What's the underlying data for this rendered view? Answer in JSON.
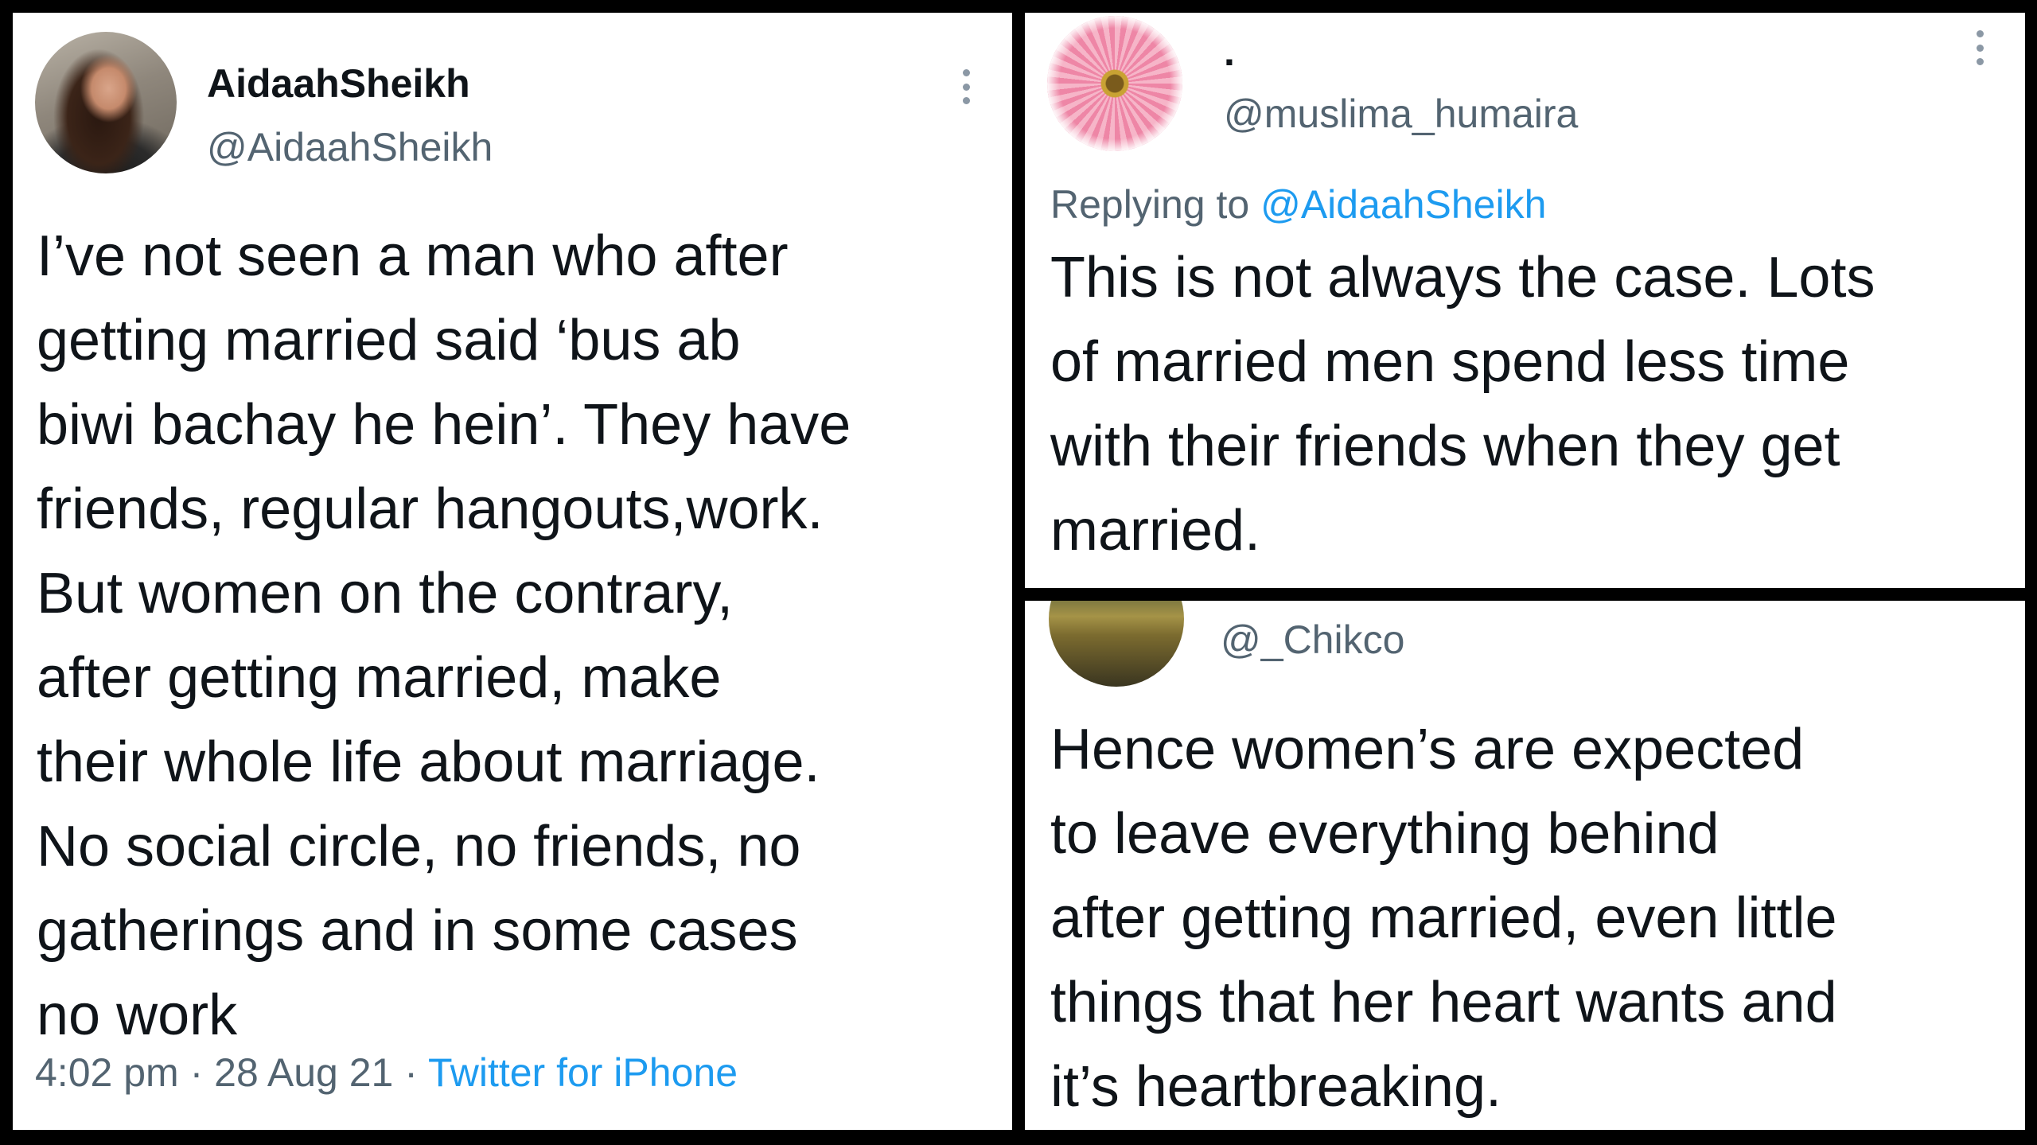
{
  "tweet": {
    "display_name": "AidaahSheikh",
    "handle": "@AidaahSheikh",
    "avatar_icon": "profile-photo",
    "text": "I’ve not seen a man who after\ngetting married said ‘bus ab\nbiwi bachay he hein’. They have\nfriends, regular hangouts,work.\nBut women on the contrary,\nafter getting married, make\ntheir whole life about marriage.\nNo social circle, no friends, no\ngatherings and in some cases\nno work",
    "time": "4:02 pm",
    "separator": "·",
    "date": "28 Aug 21",
    "source": "Twitter for iPhone",
    "menu_icon": "more-vertical-icon"
  },
  "reply_one": {
    "display_name": ".",
    "handle": "@muslima_humaira",
    "avatar_icon": "pink-flower",
    "replying_prefix": "Replying to",
    "replying_to": "@AidaahSheikh",
    "text": "This is not always the case. Lots\nof married men spend less time\nwith their friends when they get\nmarried.",
    "menu_icon": "more-vertical-icon"
  },
  "reply_two": {
    "handle": "@_Chikco",
    "avatar_icon": "wheat-field",
    "text": "Hence women’s are expected\nto leave everything behind\nafter getting married, even little\nthings that her heart wants and\nit’s heartbreaking."
  },
  "colors": {
    "text_primary": "#0f1419",
    "text_secondary": "#536471",
    "link": "#1d9bf0",
    "border": "#000000"
  }
}
